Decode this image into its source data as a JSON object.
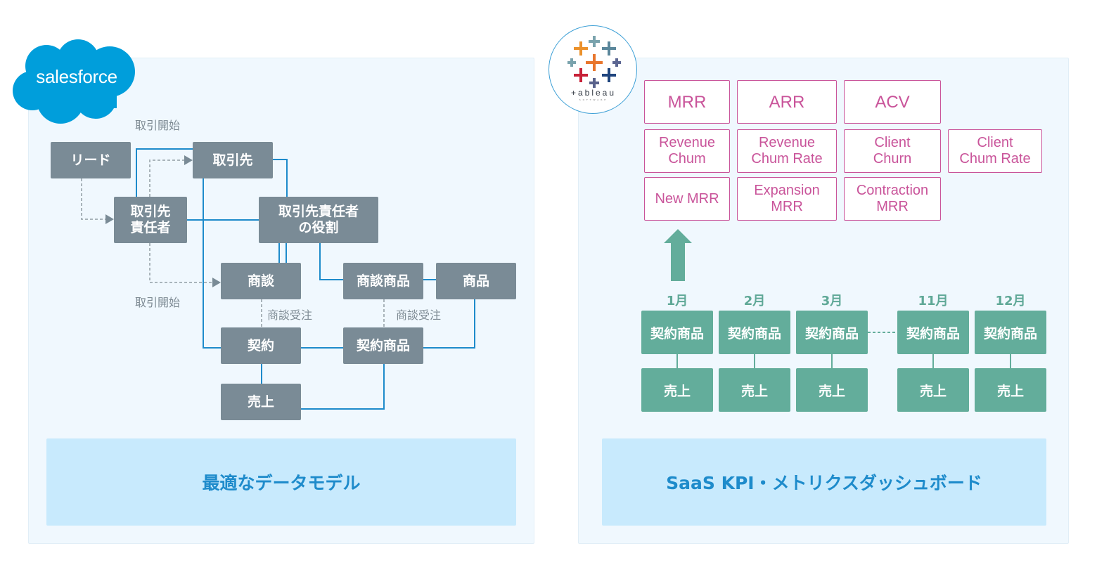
{
  "left_panel": {
    "logo": {
      "name": "salesforce",
      "text": "salesforce",
      "color": "#009edb"
    },
    "notes": {
      "deal_start_top": "取引開始",
      "deal_start_bottom": "取引開始",
      "opp_won_1": "商談受注",
      "opp_won_2": "商談受注"
    },
    "nodes": {
      "lead": "リード",
      "account": "取引先",
      "contact": "取引先\n責任者",
      "contact_role": "取引先責任者\nの役割",
      "opportunity": "商談",
      "opportunity_product": "商談商品",
      "product": "商品",
      "contract": "契約",
      "contract_product": "契約商品",
      "sales": "売上"
    },
    "footer": "最適なデータモデル"
  },
  "right_panel": {
    "logo": {
      "name": "tableau",
      "text": "+ableau",
      "subtext": "SOFTWARE"
    },
    "kpis": [
      [
        "MRR",
        "ARR",
        "ACV"
      ],
      [
        "Revenue\nChum",
        "Revenue\nChum Rate",
        "Client\nChurn",
        "Client\nChum Rate"
      ],
      [
        "New MRR",
        "Expansion\nMRR",
        "Contraction\nMRR"
      ]
    ],
    "months": [
      {
        "label": "1月",
        "product": "契約商品",
        "sales": "売上"
      },
      {
        "label": "2月",
        "product": "契約商品",
        "sales": "売上"
      },
      {
        "label": "3月",
        "product": "契約商品",
        "sales": "売上"
      },
      {
        "label": "11月",
        "product": "契約商品",
        "sales": "売上"
      },
      {
        "label": "12月",
        "product": "契約商品",
        "sales": "売上"
      }
    ],
    "footer": "SaaS KPI・メトリクスダッシュボード"
  },
  "colors": {
    "node_gray": "#7a8b96",
    "line_blue": "#1e8bcb",
    "kpi_pink": "#c9549a",
    "month_green": "#63ad9b",
    "footer_bg": "#c8eafd"
  }
}
